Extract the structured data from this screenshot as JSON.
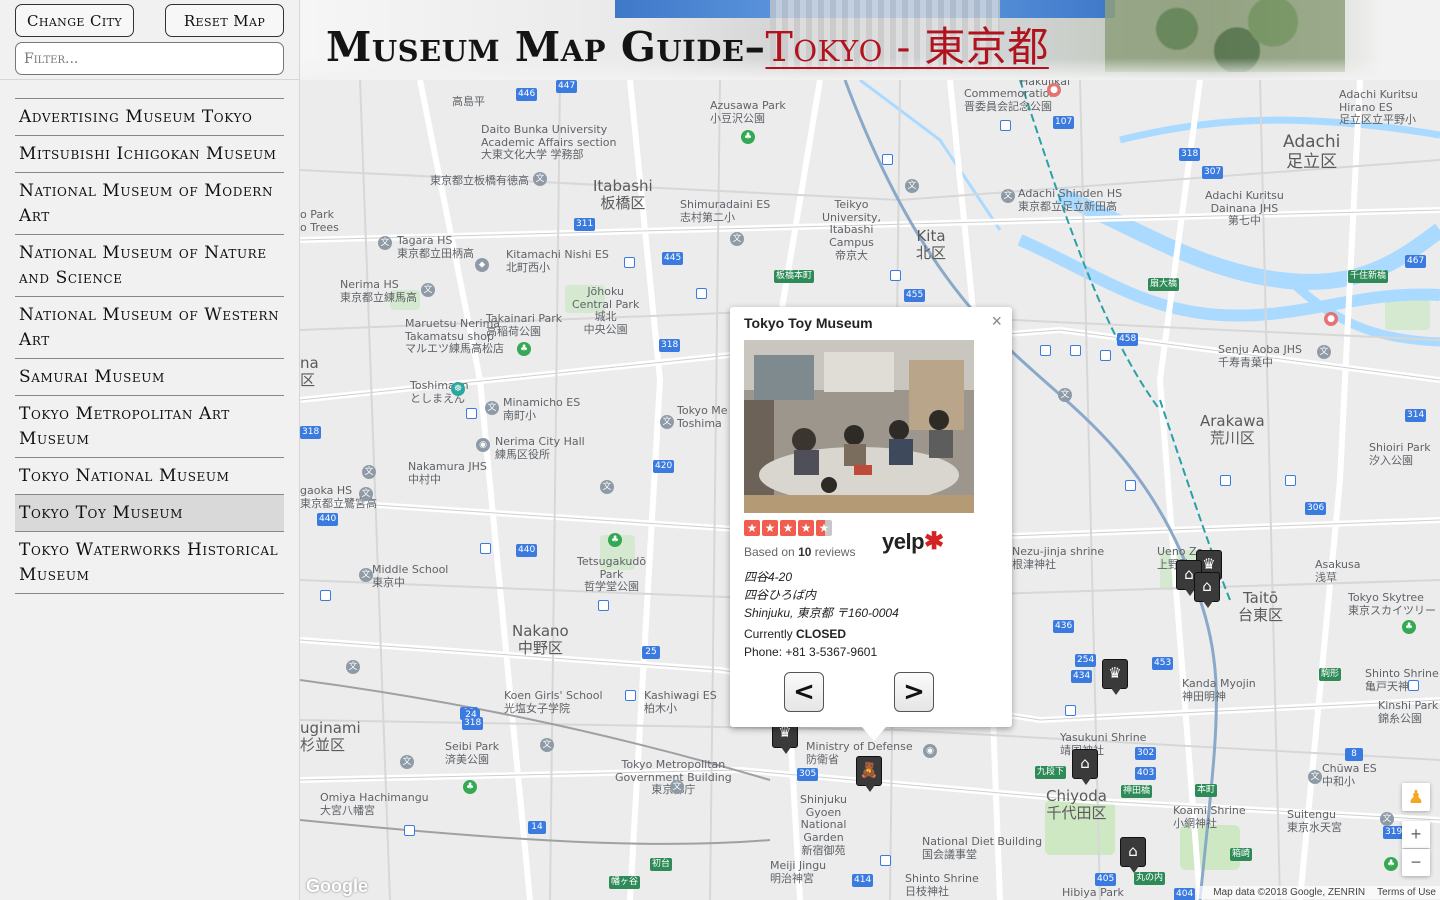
{
  "sidebar": {
    "change_city_label": "Change City",
    "reset_map_label": "Reset Map",
    "filter_placeholder": "Filter...",
    "museums": [
      "Advertising Museum Tokyo",
      "Mitsubishi Ichigokan Museum",
      "National Museum of Modern Art",
      "National Museum of Nature and Science",
      "National Museum of Western Art",
      "Samurai Museum",
      "Tokyo Metropolitan Art Museum",
      "Tokyo National Museum",
      "Tokyo Toy Museum",
      "Tokyo Waterworks Historical Museum"
    ],
    "selected_museum": "Tokyo Toy Museum"
  },
  "header": {
    "title": "Museum Map Guide",
    "separator": "–",
    "city": "Tokyo - 東京都"
  },
  "map": {
    "wards": {
      "itabashi": "Itabashi",
      "itabashi_jp": "板橋区",
      "kita": "Kita",
      "kita_jp": "北区",
      "adachi": "Adachi",
      "adachi_jp": "足立区",
      "arakawa": "Arakawa",
      "arakawa_jp": "荒川区",
      "taito": "Taitō",
      "taito_jp": "台東区",
      "nakano": "Nakano",
      "nakano_jp": "中野区",
      "chiyoda": "Chiyoda",
      "chiyoda_jp": "千代田区",
      "suginami": "uginami",
      "suginami_jp": "杉並区",
      "nerima": "na",
      "nerima_jp": "区"
    },
    "labels": {
      "azusawa": "Azusawa Park",
      "azusawa_jp": "小豆沢公園",
      "daito": "Daito Bunka University",
      "daito2": "Academic Affairs section",
      "daito_jp": "大東文化大学 学務部",
      "commemoration": "Commemoration",
      "commemoration_jp": "晋委員会記念公園",
      "hakujikai": "Hakujikai",
      "adachi_kuritsu": "Adachi Kuritsu",
      "hirano": "Hirano ES",
      "hirano_jp": "足立区立平野小",
      "takashima": "高島平",
      "itabashi_tokumaru": "東京都立板橋有徳高",
      "shimuradaini": "Shimuradaini ES",
      "shimuradaini_jp": "志村第二小",
      "teikyo": "Teikyo",
      "teikyo2": "University,",
      "teikyo3": "Itabashi",
      "teikyo4": "Campus",
      "teikyo_jp": "帝京大",
      "adachi_shinden": "Adachi Shinden HS",
      "adachi_shinden_jp": "東京都立足立新田高",
      "adachi_kuritsu2": "Adachi Kuritsu",
      "dainana": "Dainana JHS",
      "dainana_jp": "第七中",
      "tagara": "Tagara HS",
      "tagara_jp": "東京都立田柄高",
      "kitamachi": "Kitamachi Nishi ES",
      "kitamachi_jp": "北町西小",
      "jouko": "Jōhoku",
      "jouko2": "Central Park",
      "jouko_jp": "城北",
      "jouko_jp2": "中央公園",
      "park_trees": "o Park",
      "park_trees2": "o Trees",
      "nerima_hs": "Nerima HS",
      "nerima_hs_jp": "東京都立練馬高",
      "maruetsu": "Maruetsu Nerima",
      "maruetsu2": "Takamatsu shop",
      "maruetsu_jp": "マルエツ練馬高松店",
      "takainari": "Takainari Park",
      "takainari_jp": "高稲荷公園",
      "senju": "Senju Aoba JHS",
      "senju_jp": "千寿青葉中",
      "toshimaen": "Toshimaen",
      "toshimaen_jp": "としまえん",
      "minamicho": "Minamicho ES",
      "minamicho_jp": "南町小",
      "nerima_city_hall": "Nerima City Hall",
      "nerima_city_hall_jp": "練馬区役所",
      "shioiri": "Shioiri Park",
      "shioiri_jp": "汐入公園",
      "nakamura": "Nakamura JHS",
      "nakamura_jp": "中村中",
      "tokyo_met": "Tokyo Me",
      "toshima": "Toshima",
      "gaoka": "gaoka HS",
      "gaoka_jp": "東京都立鷺宮高",
      "middle_school": "Middle School",
      "middle_school_jp": "東京中",
      "tetsugakudo": "Tetsugakudō",
      "tetsugakudo2": "Park",
      "tetsugakudo_jp": "哲学堂公園",
      "nezu": "Nezu-jinja shrine",
      "nezu_jp": "根津神社",
      "ueno_zoo": "Ueno Zo",
      "ueno_jp": "上野動",
      "tokyo_skytree": "Tokyo Skytree",
      "tokyo_skytree_jp": "東京スカイツリー",
      "asakusa": "Asakusa",
      "asakusa_jp": "浅草",
      "koen_girls": "Koen Girls' School",
      "koen_girls_jp": "光塩女子学院",
      "kashiwagi": "Kashiwagi ES",
      "kashiwagi_jp": "柏木小",
      "kanda_myojin": "Kanda Myojin",
      "kanda_myojin_jp": "神田明神",
      "shinto_shrine": "Shinto Shrine",
      "shinto_shrine_jp": "亀戸天神",
      "kinshi": "Kinshi Park",
      "kinshi_jp": "錦糸公園",
      "seibi": "Seibi Park",
      "seibi_jp": "済美公園",
      "tmg": "Tokyo Metropolitan",
      "tmg2": "Government Building",
      "tmg_jp": "東京都庁",
      "defense": "Ministry of Defense",
      "defense_jp": "防衛省",
      "yasukuni": "Yasukuni Shrine",
      "yasukuni_jp": "靖国神社",
      "chuwa": "Chūwa ES",
      "chuwa_jp": "中和小",
      "omiya": "Omiya Hachimangu",
      "omiya_jp": "大宮八幡宮",
      "gyoen": "Shinjuku",
      "gyoen2": "Gyoen",
      "gyoen3": "National",
      "gyoen4": "Garden",
      "gyoen_jp": "新宿御苑",
      "koami": "Koami Shrine",
      "koami_jp": "小網神社",
      "suitengu": "Suitengu",
      "suitengu_jp": "東京水天宮",
      "diet": "National Diet Building",
      "diet_jp": "国会議事堂",
      "meiji": "Meiji Jingu",
      "meiji_jp": "明治神宮",
      "shinto_shiba": "Shinto Shrine",
      "shinto_shiba_jp": "日枝神社",
      "hibiya": "Hibiya Park",
      "hibiya_jp": "日比谷公園"
    },
    "route_shields": [
      "447",
      "446",
      "107",
      "318",
      "307",
      "311",
      "445",
      "455",
      "467",
      "458",
      "318",
      "420",
      "440",
      "436",
      "254",
      "434",
      "453",
      "302",
      "403",
      "305",
      "319",
      "306",
      "14",
      "25",
      "13",
      "414",
      "405",
      "404",
      "314",
      "318",
      "440",
      "24",
      "8",
      "318"
    ],
    "station_names": [
      "板橋本町",
      "扇大橋",
      "千住新橋",
      "初台",
      "幡ヶ谷",
      "神田橋",
      "丸の内",
      "本町",
      "箱崎",
      "駒形",
      "九段下"
    ],
    "info_window": {
      "title": "Tokyo Toy Museum",
      "rating": 4.5,
      "review_prefix": "Based on",
      "review_count": "10",
      "review_suffix": "reviews",
      "yelp_label": "yelp",
      "address_line1": "四谷4-20",
      "address_line2": "四谷ひろば内",
      "address_line3": "Shinjuku, 東京都 〒160-0004",
      "status_prefix": "Currently",
      "status": "CLOSED",
      "phone": "Phone: +81 3-5367-9601",
      "prev_label": "<",
      "next_label": ">",
      "close_label": "×"
    },
    "controls": {
      "zoom_in": "+",
      "zoom_out": "−",
      "google": "Google",
      "attribution": "Map data ©2018 Google, ZENRIN",
      "terms": "Terms of Use"
    }
  },
  "colors": {
    "accent_red": "#b1131e",
    "water": "#aadaff",
    "route_blue": "#3b7be0",
    "marker_dark": "#3a3a3a",
    "yelp_red": "#d32323"
  }
}
